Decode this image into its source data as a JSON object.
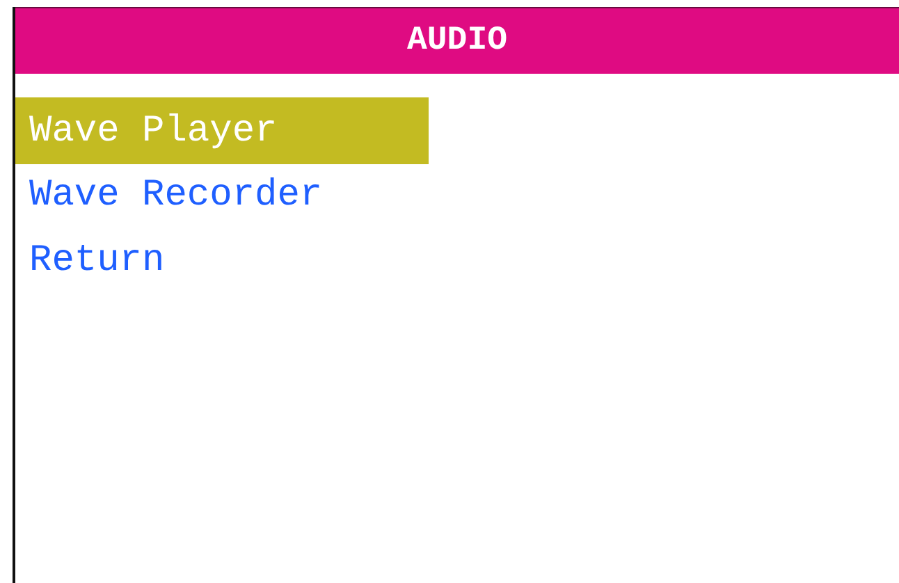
{
  "header": {
    "title": "AUDIO"
  },
  "menu": [
    {
      "label": "Wave Player",
      "selected": true
    },
    {
      "label": "Wave Recorder",
      "selected": false
    },
    {
      "label": "Return",
      "selected": false
    }
  ]
}
